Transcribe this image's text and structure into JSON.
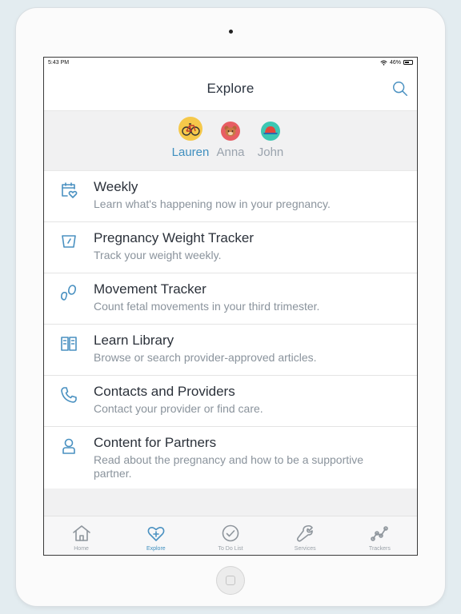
{
  "status": {
    "time": "5:43 PM",
    "battery": "46%"
  },
  "header": {
    "title": "Explore"
  },
  "profiles": [
    {
      "name": "Lauren",
      "active": true,
      "icon": "bicycle-avatar-icon"
    },
    {
      "name": "Anna",
      "active": false,
      "icon": "bear-avatar-icon"
    },
    {
      "name": "John",
      "active": false,
      "icon": "hat-avatar-icon"
    }
  ],
  "menu": [
    {
      "title": "Weekly",
      "subtitle": "Learn what's happening now in your pregnancy.",
      "icon": "calendar-heart-icon"
    },
    {
      "title": "Pregnancy Weight Tracker",
      "subtitle": "Track your weight weekly.",
      "icon": "scale-icon"
    },
    {
      "title": "Movement Tracker",
      "subtitle": "Count fetal movements in your third trimester.",
      "icon": "footprints-icon"
    },
    {
      "title": "Learn Library",
      "subtitle": "Browse or search provider-approved articles.",
      "icon": "book-icon"
    },
    {
      "title": "Contacts and Providers",
      "subtitle": "Contact your provider or find care.",
      "icon": "phone-icon"
    },
    {
      "title": "Content for Partners",
      "subtitle": "Read about the pregnancy and how to be a supportive partner.",
      "icon": "person-icon"
    }
  ],
  "tabs": [
    {
      "label": "Home",
      "icon": "home-icon"
    },
    {
      "label": "Explore",
      "icon": "heart-plus-icon",
      "active": true
    },
    {
      "label": "To Do List",
      "icon": "check-circle-icon"
    },
    {
      "label": "Services",
      "icon": "wrench-icon"
    },
    {
      "label": "Trackers",
      "icon": "trend-line-icon"
    }
  ],
  "colors": {
    "accent": "#3f8fbf",
    "icon": "#4a91c1",
    "tab_inactive": "#8e959c"
  }
}
